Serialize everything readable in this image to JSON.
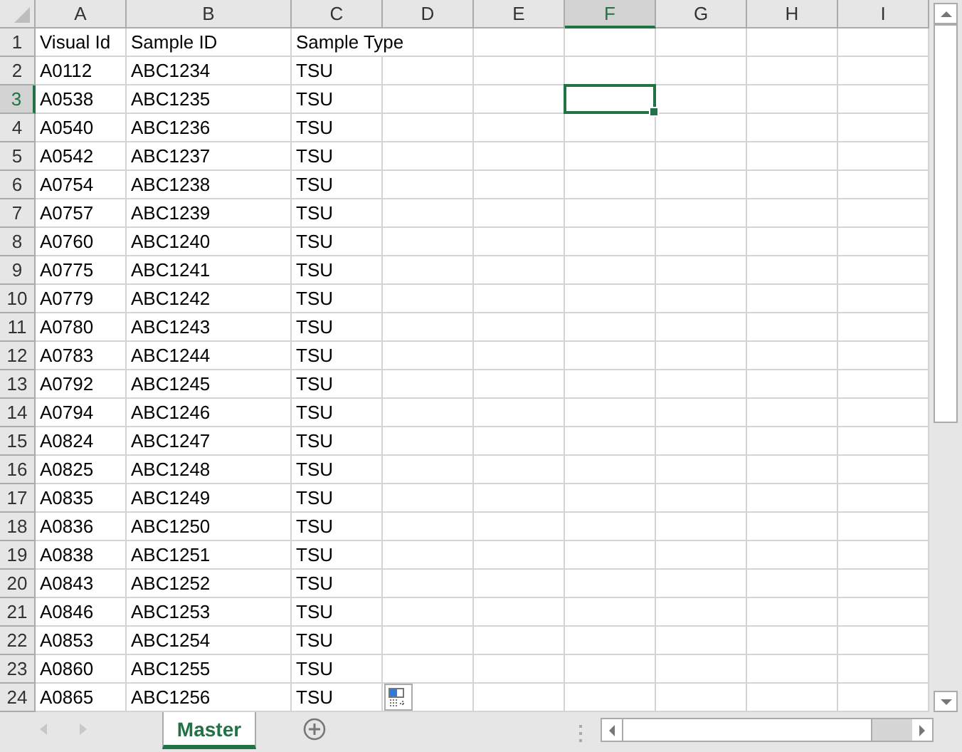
{
  "columns": [
    {
      "label": "A",
      "selected": false
    },
    {
      "label": "B",
      "selected": false
    },
    {
      "label": "C",
      "selected": false
    },
    {
      "label": "D",
      "selected": false
    },
    {
      "label": "E",
      "selected": false
    },
    {
      "label": "F",
      "selected": true
    },
    {
      "label": "G",
      "selected": false
    },
    {
      "label": "H",
      "selected": false
    },
    {
      "label": "I",
      "selected": false
    }
  ],
  "rows": [
    {
      "number": "1",
      "selected": false,
      "cells": [
        "Visual Id",
        "Sample ID",
        "Sample Type"
      ]
    },
    {
      "number": "2",
      "selected": false,
      "cells": [
        "A0112",
        "ABC1234",
        "TSU"
      ]
    },
    {
      "number": "3",
      "selected": true,
      "cells": [
        "A0538",
        "ABC1235",
        "TSU"
      ]
    },
    {
      "number": "4",
      "selected": false,
      "cells": [
        "A0540",
        "ABC1236",
        "TSU"
      ]
    },
    {
      "number": "5",
      "selected": false,
      "cells": [
        "A0542",
        "ABC1237",
        "TSU"
      ]
    },
    {
      "number": "6",
      "selected": false,
      "cells": [
        "A0754",
        "ABC1238",
        "TSU"
      ]
    },
    {
      "number": "7",
      "selected": false,
      "cells": [
        "A0757",
        "ABC1239",
        "TSU"
      ]
    },
    {
      "number": "8",
      "selected": false,
      "cells": [
        "A0760",
        "ABC1240",
        "TSU"
      ]
    },
    {
      "number": "9",
      "selected": false,
      "cells": [
        "A0775",
        "ABC1241",
        "TSU"
      ]
    },
    {
      "number": "10",
      "selected": false,
      "cells": [
        "A0779",
        "ABC1242",
        "TSU"
      ]
    },
    {
      "number": "11",
      "selected": false,
      "cells": [
        "A0780",
        "ABC1243",
        "TSU"
      ]
    },
    {
      "number": "12",
      "selected": false,
      "cells": [
        "A0783",
        "ABC1244",
        "TSU"
      ]
    },
    {
      "number": "13",
      "selected": false,
      "cells": [
        "A0792",
        "ABC1245",
        "TSU"
      ]
    },
    {
      "number": "14",
      "selected": false,
      "cells": [
        "A0794",
        "ABC1246",
        "TSU"
      ]
    },
    {
      "number": "15",
      "selected": false,
      "cells": [
        "A0824",
        "ABC1247",
        "TSU"
      ]
    },
    {
      "number": "16",
      "selected": false,
      "cells": [
        "A0825",
        "ABC1248",
        "TSU"
      ]
    },
    {
      "number": "17",
      "selected": false,
      "cells": [
        "A0835",
        "ABC1249",
        "TSU"
      ]
    },
    {
      "number": "18",
      "selected": false,
      "cells": [
        "A0836",
        "ABC1250",
        "TSU"
      ]
    },
    {
      "number": "19",
      "selected": false,
      "cells": [
        "A0838",
        "ABC1251",
        "TSU"
      ]
    },
    {
      "number": "20",
      "selected": false,
      "cells": [
        "A0843",
        "ABC1252",
        "TSU"
      ]
    },
    {
      "number": "21",
      "selected": false,
      "cells": [
        "A0846",
        "ABC1253",
        "TSU"
      ]
    },
    {
      "number": "22",
      "selected": false,
      "cells": [
        "A0853",
        "ABC1254",
        "TSU"
      ]
    },
    {
      "number": "23",
      "selected": false,
      "cells": [
        "A0860",
        "ABC1255",
        "TSU"
      ]
    },
    {
      "number": "24",
      "selected": false,
      "cells": [
        "A0865",
        "ABC1256",
        "TSU"
      ]
    }
  ],
  "sheet_tabs": [
    {
      "label": "Master",
      "selected": true
    }
  ]
}
